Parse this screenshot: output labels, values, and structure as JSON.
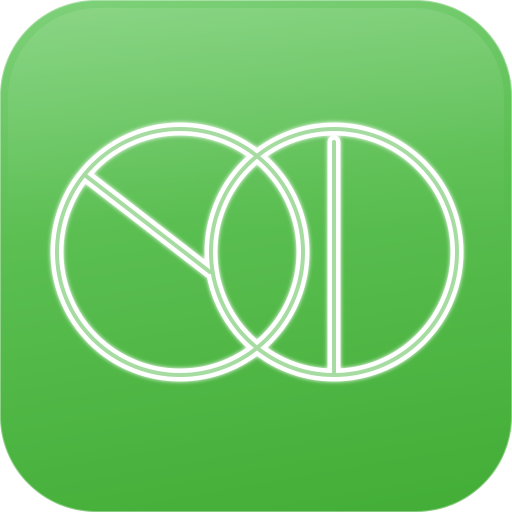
{
  "app_icon": {
    "icon_name": "linked-circles-logo-icon",
    "colors": {
      "background_top": "#7fd17a",
      "background_mid": "#5bbf52",
      "background_bottom": "#42ad36",
      "stroke": "#ffffff",
      "stroke_inner": "#e9f7e6"
    }
  }
}
